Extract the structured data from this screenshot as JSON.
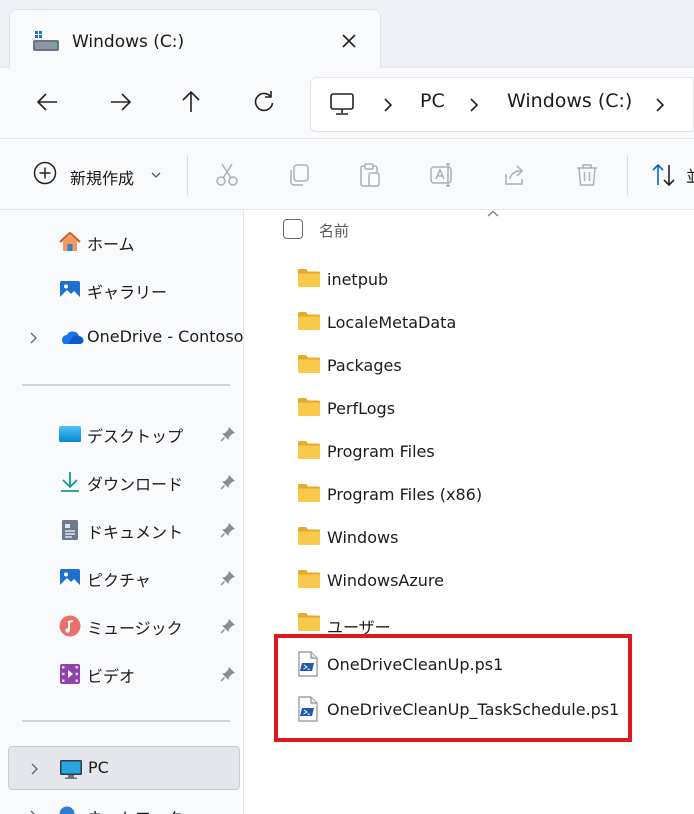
{
  "colors": {
    "accent": "#0067c0",
    "folder": "#f8c94a",
    "highlight": "#e0171f"
  },
  "tab": {
    "title": "Windows (C:)",
    "icon": "drive-icon",
    "close_icon": "close-icon"
  },
  "nav": {
    "back_icon": "back-arrow-icon",
    "forward_icon": "forward-arrow-icon",
    "up_icon": "up-arrow-icon",
    "refresh_icon": "refresh-icon"
  },
  "address": {
    "segments": [
      "PC",
      "Windows (C:)"
    ],
    "root_icon": "pc-icon"
  },
  "toolbar": {
    "new_label": "新規作成",
    "sort_label": "並",
    "icons": [
      "cut-icon",
      "copy-icon",
      "paste-icon",
      "rename-icon",
      "share-icon",
      "delete-icon"
    ]
  },
  "sidebar": {
    "top_items": [
      {
        "label": "ホーム",
        "icon": "home-icon"
      },
      {
        "label": "ギャラリー",
        "icon": "gallery-icon"
      },
      {
        "label": "OneDrive - Contoso",
        "icon": "onedrive-icon"
      }
    ],
    "quick_access": [
      {
        "label": "デスクトップ",
        "icon": "desktop-icon"
      },
      {
        "label": "ダウンロード",
        "icon": "download-icon"
      },
      {
        "label": "ドキュメント",
        "icon": "document-icon"
      },
      {
        "label": "ピクチャ",
        "icon": "pictures-icon"
      },
      {
        "label": "ミュージック",
        "icon": "music-icon"
      },
      {
        "label": "ビデオ",
        "icon": "video-icon"
      }
    ],
    "bottom_items": [
      {
        "label": "PC",
        "icon": "pc-icon"
      },
      {
        "label": "ネットワーク",
        "icon": "network-icon"
      }
    ]
  },
  "content": {
    "column_header": "名前",
    "folders": [
      "inetpub",
      "LocaleMetaData",
      "Packages",
      "PerfLogs",
      "Program Files",
      "Program Files (x86)",
      "Windows",
      "WindowsAzure",
      "ユーザー"
    ],
    "files": [
      "OneDriveCleanUp.ps1",
      "OneDriveCleanUp_TaskSchedule.ps1"
    ]
  }
}
